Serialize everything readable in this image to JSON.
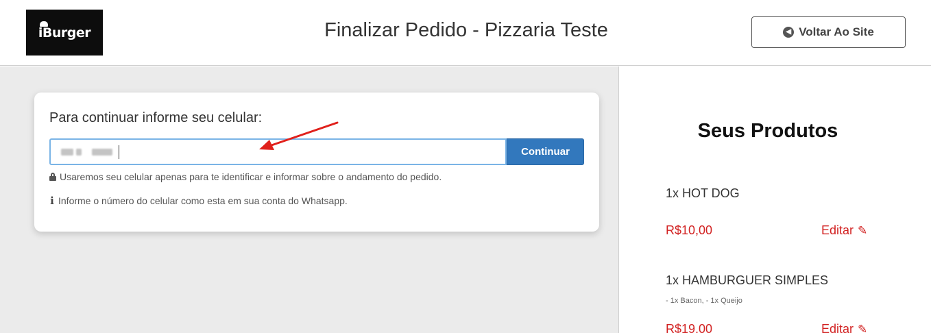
{
  "header": {
    "logo_text": "iBurger",
    "title": "Finalizar Pedido - Pizzaria Teste",
    "back_button_label": "Voltar Ao Site"
  },
  "form": {
    "prompt": "Para continuar informe seu celular:",
    "phone_value": "",
    "continue_label": "Continuar",
    "privacy_note": "Usaremos seu celular apenas para te identificar e informar sobre o andamento do pedido.",
    "info_note": "Informe o número do celular como esta em sua conta do Whatsapp."
  },
  "sidebar": {
    "title": "Seus Produtos",
    "edit_label": "Editar",
    "products": [
      {
        "name": "1x HOT DOG",
        "extras": "",
        "price": "R$10,00"
      },
      {
        "name": "1x HAMBURGUER SIMPLES",
        "extras": "- 1x Bacon, - 1x Queijo",
        "price": "R$19,00"
      }
    ]
  },
  "colors": {
    "accent": "#3278bd",
    "price": "#d22222",
    "arrow": "#e0201b",
    "main_bg": "#ebebeb"
  },
  "icons": {
    "back": "arrow-circle-left-icon",
    "lock": "lock-icon",
    "info": "info-icon",
    "edit": "edit-icon"
  }
}
